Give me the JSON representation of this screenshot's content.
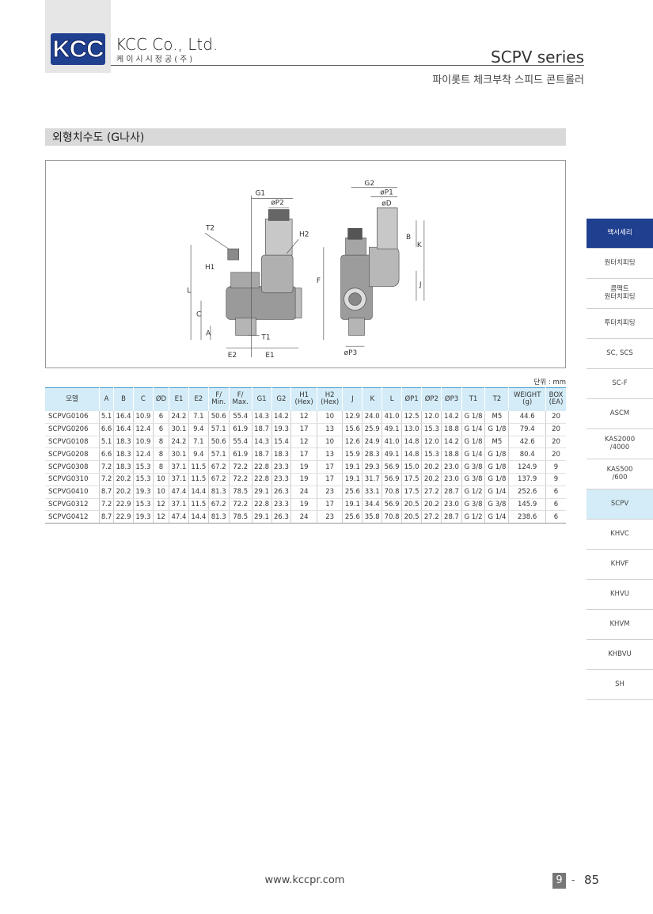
{
  "header": {
    "logo_text": "KCC",
    "company": "KCC Co., Ltd.",
    "company_ko": "케이시시정공(주)",
    "series": "SCPV series",
    "series_sub": "파이롯트 체크부착 스피드 콘트롤러"
  },
  "section": {
    "title": "외형치수도 (G나사)"
  },
  "drawing": {
    "labels": [
      "G1",
      "øP2",
      "T2",
      "H2",
      "H1",
      "L",
      "C",
      "A",
      "T1",
      "E2",
      "E1",
      "G2",
      "øP1",
      "øD",
      "B",
      "K",
      "F",
      "J",
      "øP3"
    ]
  },
  "table": {
    "unit": "단위 : mm",
    "columns": [
      [
        "모델"
      ],
      [
        "A"
      ],
      [
        "B"
      ],
      [
        "C"
      ],
      [
        "ØD"
      ],
      [
        "E1"
      ],
      [
        "E2"
      ],
      [
        "F/",
        "Min."
      ],
      [
        "F/",
        "Max."
      ],
      [
        "G1"
      ],
      [
        "G2"
      ],
      [
        "H1",
        "(Hex)"
      ],
      [
        "H2",
        "(Hex)"
      ],
      [
        "J"
      ],
      [
        "K"
      ],
      [
        "L"
      ],
      [
        "ØP1"
      ],
      [
        "ØP2"
      ],
      [
        "ØP3"
      ],
      [
        "T1"
      ],
      [
        "T2"
      ],
      [
        "WEIGHT",
        "(g)"
      ],
      [
        "BOX",
        "(EA)"
      ]
    ],
    "rows": [
      [
        "SCPVG0106",
        "5.1",
        "16.4",
        "10.9",
        "6",
        "24.2",
        "7.1",
        "50.6",
        "55.4",
        "14.3",
        "14.2",
        "12",
        "10",
        "12.9",
        "24.0",
        "41.0",
        "12.5",
        "12.0",
        "14.2",
        "G 1/8",
        "M5",
        "44.6",
        "20"
      ],
      [
        "SCPVG0206",
        "6.6",
        "16.4",
        "12.4",
        "6",
        "30.1",
        "9.4",
        "57.1",
        "61.9",
        "18.7",
        "19.3",
        "17",
        "13",
        "15.6",
        "25.9",
        "49.1",
        "13.0",
        "15.3",
        "18.8",
        "G 1/4",
        "G 1/8",
        "79.4",
        "20"
      ],
      [
        "SCPVG0108",
        "5.1",
        "18.3",
        "10.9",
        "8",
        "24.2",
        "7.1",
        "50.6",
        "55.4",
        "14.3",
        "15.4",
        "12",
        "10",
        "12.6",
        "24.9",
        "41.0",
        "14.8",
        "12.0",
        "14.2",
        "G 1/8",
        "M5",
        "42.6",
        "20"
      ],
      [
        "SCPVG0208",
        "6.6",
        "18.3",
        "12.4",
        "8",
        "30.1",
        "9.4",
        "57.1",
        "61.9",
        "18.7",
        "18.3",
        "17",
        "13",
        "15.9",
        "28.3",
        "49.1",
        "14.8",
        "15.3",
        "18.8",
        "G 1/4",
        "G 1/8",
        "80.4",
        "20"
      ],
      [
        "SCPVG0308",
        "7.2",
        "18.3",
        "15.3",
        "8",
        "37.1",
        "11.5",
        "67.2",
        "72.2",
        "22.8",
        "23.3",
        "19",
        "17",
        "19.1",
        "29.3",
        "56.9",
        "15.0",
        "20.2",
        "23.0",
        "G 3/8",
        "G 1/8",
        "124.9",
        "9"
      ],
      [
        "SCPVG0310",
        "7.2",
        "20.2",
        "15.3",
        "10",
        "37.1",
        "11.5",
        "67.2",
        "72.2",
        "22.8",
        "23.3",
        "19",
        "17",
        "19.1",
        "31.7",
        "56.9",
        "17.5",
        "20.2",
        "23.0",
        "G 3/8",
        "G 1/8",
        "137.9",
        "9"
      ],
      [
        "SCPVG0410",
        "8.7",
        "20.2",
        "19.3",
        "10",
        "47.4",
        "14.4",
        "81.3",
        "78.5",
        "29.1",
        "26.3",
        "24",
        "23",
        "25.6",
        "33.1",
        "70.8",
        "17.5",
        "27.2",
        "28.7",
        "G 1/2",
        "G 1/4",
        "252.6",
        "6"
      ],
      [
        "SCPVG0312",
        "7.2",
        "22.9",
        "15.3",
        "12",
        "37.1",
        "11.5",
        "67.2",
        "72.2",
        "22.8",
        "23.3",
        "19",
        "17",
        "19.1",
        "34.4",
        "56.9",
        "20.5",
        "20.2",
        "23.0",
        "G 3/8",
        "G 3/8",
        "145.9",
        "6"
      ],
      [
        "SCPVG0412",
        "8.7",
        "22.9",
        "19.3",
        "12",
        "47.4",
        "14.4",
        "81.3",
        "78.5",
        "29.1",
        "26.3",
        "24",
        "23",
        "25.6",
        "35.8",
        "70.8",
        "20.5",
        "27.2",
        "28.7",
        "G 1/2",
        "G 1/4",
        "238.6",
        "6"
      ]
    ]
  },
  "sidebar": {
    "items": [
      {
        "label": "액서세리",
        "state": "first"
      },
      {
        "label": "원터치피팅",
        "state": ""
      },
      {
        "label": "콤팩트\n원터치피팅",
        "state": ""
      },
      {
        "label": "투터치피팅",
        "state": ""
      },
      {
        "label": "SC, SCS",
        "state": ""
      },
      {
        "label": "SC-F",
        "state": ""
      },
      {
        "label": "ASCM",
        "state": ""
      },
      {
        "label": "KAS2000\n/4000",
        "state": ""
      },
      {
        "label": "KAS500\n/600",
        "state": ""
      },
      {
        "label": "SCPV",
        "state": "active"
      },
      {
        "label": "KHVC",
        "state": ""
      },
      {
        "label": "KHVF",
        "state": ""
      },
      {
        "label": "KHVU",
        "state": ""
      },
      {
        "label": "KHVM",
        "state": ""
      },
      {
        "label": "KHBVU",
        "state": ""
      },
      {
        "label": "SH",
        "state": ""
      }
    ]
  },
  "footer": {
    "url": "www.kccpr.com",
    "chapter": "9",
    "dash": "-",
    "page": "85"
  }
}
